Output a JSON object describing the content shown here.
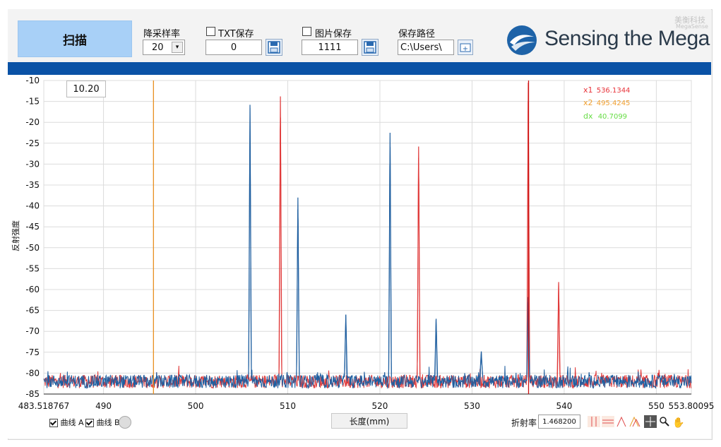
{
  "toolbar": {
    "scan_label": "扫描",
    "downsample_label": "降采样率",
    "downsample_value": "20",
    "txt_save_label": "TXT保存",
    "txt_save_value": "0",
    "img_save_label": "图片保存",
    "img_save_value": "1111",
    "save_path_label": "保存路径",
    "save_path_value": "C:\\Users\\",
    "brand_text": "Sensing the Mega",
    "watermark_cn": "美衡科技",
    "watermark_en": "MegaSense"
  },
  "plot": {
    "y_scale_box": "10.20",
    "cursors": [
      {
        "label": "x1",
        "value": "536.1344",
        "color": "#e8333a"
      },
      {
        "label": "x2",
        "value": "495.4245",
        "color": "#f0a030"
      },
      {
        "label": "dx",
        "value": "40.7099",
        "color": "#66dd44"
      }
    ]
  },
  "bottom": {
    "curve_a_label": "曲线 A",
    "curve_b_label": "曲线 B",
    "xlabel_box": "长度(mm)",
    "refr_label": "折射率",
    "refr_value": "1.468200"
  },
  "colors": {
    "series_a": "#1f5fa0",
    "series_b": "#e03a3a",
    "cursor_x1": "#cc1111",
    "cursor_x2": "#e89020",
    "accent_bar": "#0a52a6"
  },
  "chart_data": {
    "type": "line",
    "title": "",
    "xlabel": "长度(mm)",
    "ylabel": "反射强度",
    "xlim": [
      483.518767,
      553.80095
    ],
    "ylim": [
      -85,
      -10
    ],
    "x_tick_labels": [
      "483.518767",
      "490",
      "500",
      "510",
      "520",
      "530",
      "540",
      "550",
      "553.80095"
    ],
    "x_tick_values": [
      483.518767,
      490,
      500,
      510,
      520,
      530,
      540,
      550,
      553.80095
    ],
    "y_ticks": [
      -10,
      -15,
      -20,
      -25,
      -30,
      -35,
      -40,
      -45,
      -50,
      -55,
      -60,
      -65,
      -70,
      -75,
      -80,
      -85
    ],
    "grid": true,
    "noise_floor": -82,
    "series": [
      {
        "key": "A",
        "color": "#1f5fa0",
        "peaks": [
          [
            505.9,
            -15.8
          ],
          [
            511.1,
            -38.0
          ],
          [
            516.3,
            -66.0
          ],
          [
            521.1,
            -22.5
          ],
          [
            526.1,
            -67.0
          ],
          [
            531.0,
            -74.8
          ],
          [
            536.1,
            -61.8
          ]
        ]
      },
      {
        "key": "B",
        "color": "#e03a3a",
        "peaks": [
          [
            509.2,
            -13.8
          ],
          [
            524.2,
            -25.8
          ],
          [
            536.1,
            -10.5
          ],
          [
            539.4,
            -58.2
          ]
        ]
      }
    ],
    "cursors_x": [
      {
        "label": "x1",
        "x": 536.1344
      },
      {
        "label": "x2",
        "x": 495.4245
      }
    ]
  }
}
